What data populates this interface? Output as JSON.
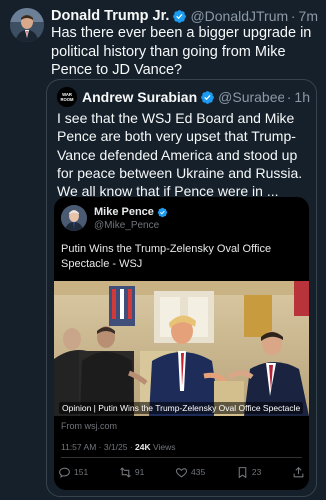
{
  "tweet": {
    "author_name": "Donald Trump Jr.",
    "author_handle": "@DonaldJTrum...",
    "separator": "·",
    "time": "7m",
    "text": "Has there ever been a bigger upgrade in political history than going from Mike Pence to JD Vance?"
  },
  "quote": {
    "author_name": "Andrew Surabian",
    "author_handle": "@Surabees",
    "separator": "·",
    "time": "1h",
    "avatar_label": "WAR ROOM",
    "text": "I see that the WSJ Ed Board and Mike Pence are both very upset that Trump-Vance defended America and stood up for peace between Ukraine and Russia. We all know that if Pence were in ...",
    "embedded": {
      "author_name": "Mike Pence",
      "author_handle": "@Mike_Pence",
      "text": "Putin Wins the Trump-Zelensky Oval Office Spectacle - WSJ",
      "image_caption": "Opinion | Putin Wins the Trump-Zelensky Oval Office Spectacle",
      "link_source": "From wsj.com",
      "timestamp": "11:57 AM · 3/1/25 ·",
      "views_count": "24K",
      "views_label": "Views",
      "replies": "151",
      "reposts": "91",
      "likes": "435",
      "bookmarks": "23"
    }
  },
  "colors": {
    "background": "#15202b",
    "verified": "#1d9bf0",
    "muted": "#8b98a5",
    "border": "#38444d"
  }
}
